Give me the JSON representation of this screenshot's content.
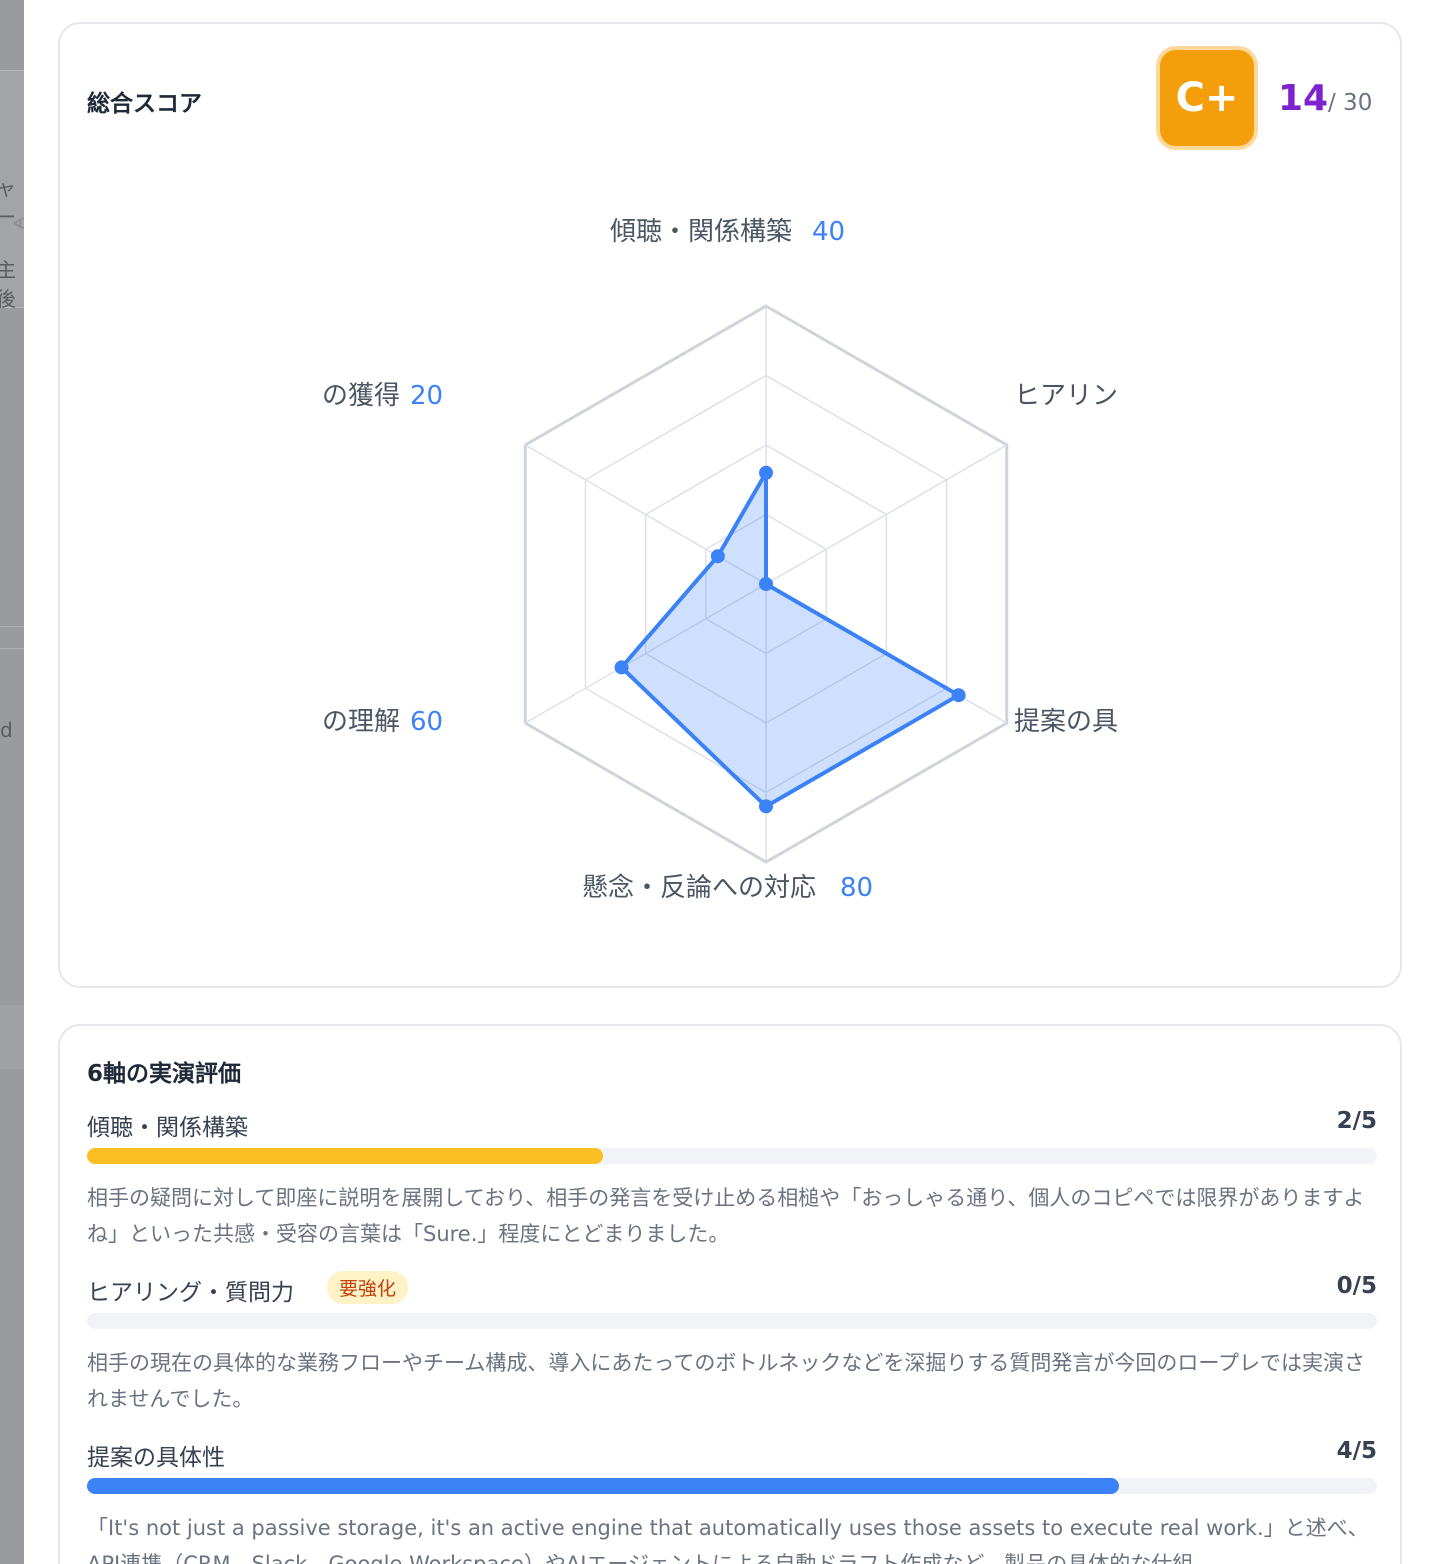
{
  "background": {
    "fragments": [
      "ャー",
      "∢",
      "主後",
      "d"
    ]
  },
  "score_card": {
    "title": "総合スコア",
    "grade": "C+",
    "score": "14",
    "score_max": "/ 30",
    "grade_color": "#f59e0b"
  },
  "chart_data": {
    "type": "radar",
    "axes": [
      {
        "label": "傾聴・関係構築",
        "value": 40
      },
      {
        "label": "ヒアリン",
        "value": 0
      },
      {
        "label": "提案の具",
        "value": 80
      },
      {
        "label": "懸念・反論への対応",
        "value": 80
      },
      {
        "label": "の理解",
        "value": 60
      },
      {
        "label": "の獲得",
        "value": 20
      }
    ],
    "value_labels": {
      "top": "40",
      "upper_left": "20",
      "lower_left": "60",
      "bottom": "80"
    },
    "range": [
      0,
      100
    ],
    "rings": 4,
    "color": "#3b82f6"
  },
  "eval_card": {
    "title": "6軸の実演評価",
    "items": [
      {
        "name": "傾聴・関係構築",
        "score": "2/5",
        "fraction": 0.4,
        "color": "#fbbf24",
        "badge": "",
        "description": "相手の疑問に対して即座に説明を展開しており、相手の発言を受け止める相槌や「おっしゃる通り、個人のコピペでは限界がありますよね」といった共感・受容の言葉は「Sure.」程度にとどまりました。"
      },
      {
        "name": "ヒアリング・質問力",
        "score": "0/5",
        "fraction": 0,
        "color": "#ef4444",
        "badge": "要強化",
        "description": "相手の現在の具体的な業務フローやチーム構成、導入にあたってのボトルネックなどを深掘りする質問発言が今回のロープレでは実演されませんでした。"
      },
      {
        "name": "提案の具体性",
        "score": "4/5",
        "fraction": 0.8,
        "color": "#3b82f6",
        "badge": "",
        "description": "「It's not just a passive storage, it's an active engine that automatically uses those assets to execute real work.」と述べ、API連携（CRM、Slack、Google Workspace）やAIエージェントによる自動ドラフト作成など、製品の具体的な仕組"
      }
    ]
  }
}
